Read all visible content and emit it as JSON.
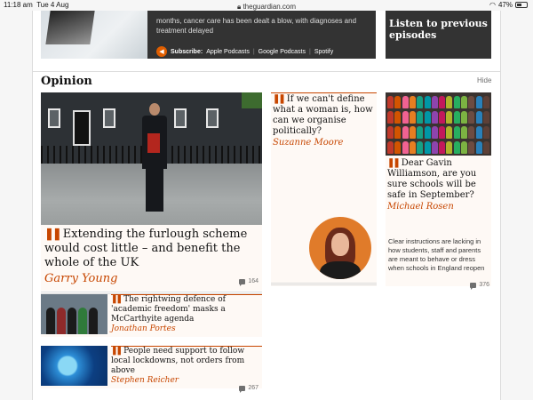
{
  "status_bar": {
    "time": "11:18 am",
    "date": "Tue 4 Aug",
    "url": "theguardian.com",
    "battery": "47%",
    "battery_level": 0.47
  },
  "podcast": {
    "text": "months, cancer care has been dealt a blow, with diagnoses and treatment delayed",
    "subscribe_label": "Subscribe:",
    "links": [
      "Apple Podcasts",
      "Google Podcasts",
      "Spotify"
    ],
    "listen_card": "Listen to previous episodes"
  },
  "section": {
    "title": "Opinion",
    "hide_label": "Hide"
  },
  "main_story": {
    "headline": "Extending the furlough scheme would cost little – and benefit the whole of the UK",
    "byline": "Garry Young",
    "comments": "164"
  },
  "mid_story": {
    "headline": "If we can't define what a woman is, how can we organise politically?",
    "byline": "Suzanne Moore"
  },
  "right_story": {
    "headline": "Dear Gavin Williamson, are you sure schools will be safe in September?",
    "byline": "Michael Rosen",
    "trail": "Clear instructions are lacking in how students, staff and parents are meant to behave or dress when schools in England reopen",
    "comments": "376"
  },
  "small_stories": [
    {
      "headline": "The rightwing defence of 'academic freedom' masks a McCarthyite agenda",
      "byline": "Jonathan Portes"
    },
    {
      "headline": "People need support to follow local lockdowns, not orders from above",
      "byline": "Stephen Reicher",
      "comments": "267"
    }
  ],
  "colors": {
    "opinion_accent": "#c74600",
    "card_bg": "#fef9f5",
    "dark_card": "#333333"
  }
}
